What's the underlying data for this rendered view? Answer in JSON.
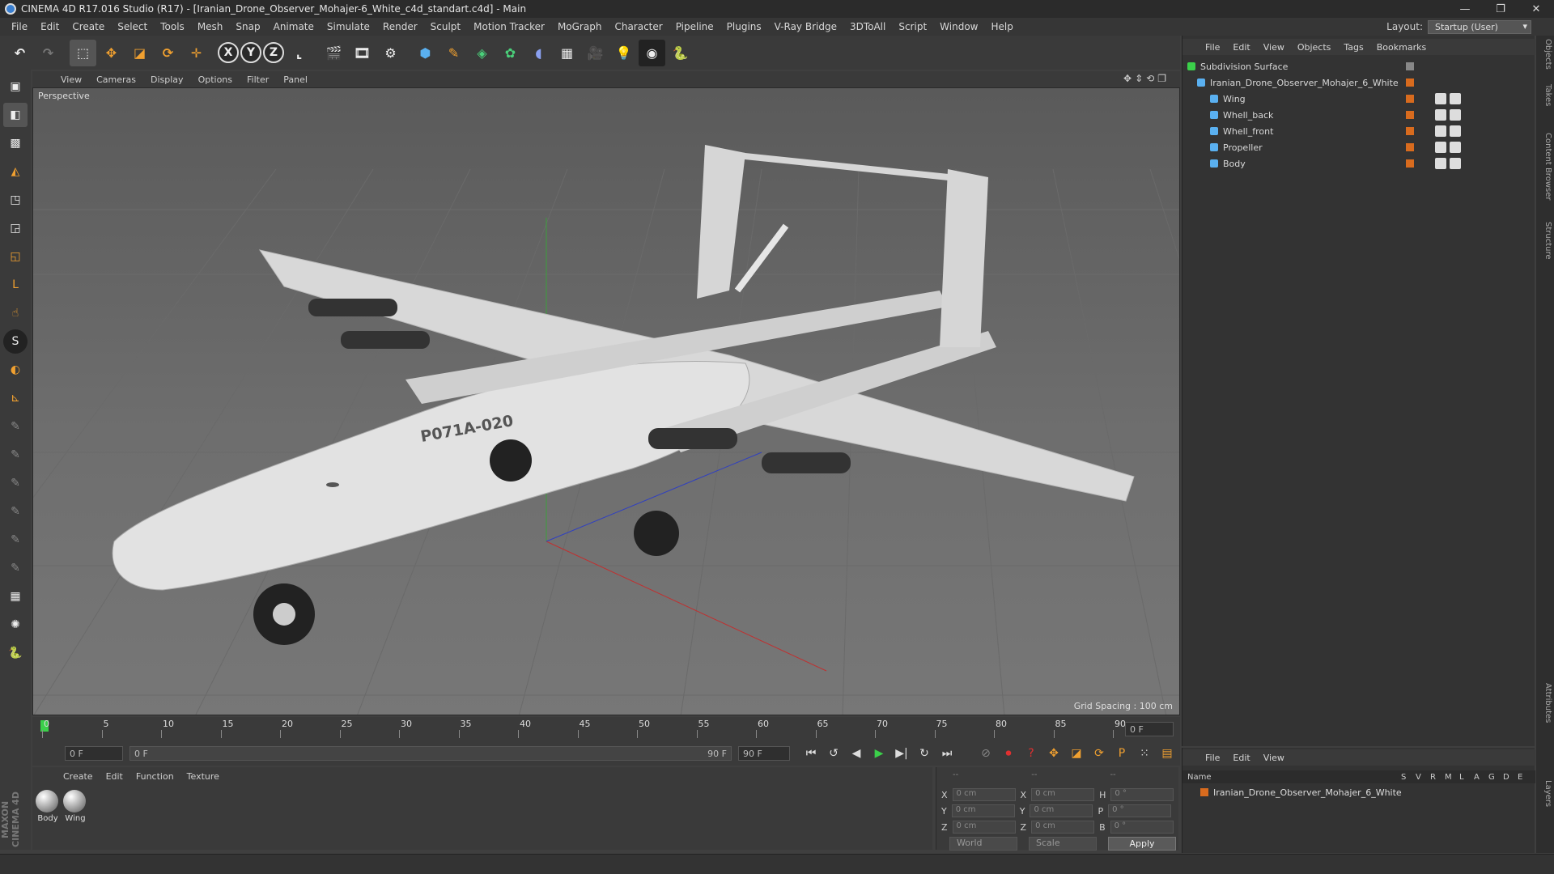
{
  "app": {
    "title": "CINEMA 4D R17.016 Studio (R17) - [Iranian_Drone_Observer_Mohajer-6_White_c4d_standart.c4d] - Main",
    "menus": [
      "File",
      "Edit",
      "Create",
      "Select",
      "Tools",
      "Mesh",
      "Snap",
      "Animate",
      "Simulate",
      "Render",
      "Sculpt",
      "Motion Tracker",
      "MoGraph",
      "Character",
      "Pipeline",
      "Plugins",
      "V-Ray Bridge",
      "3DToAll",
      "Script",
      "Window",
      "Help"
    ],
    "layout_label": "Layout:",
    "layout_value": "Startup (User)"
  },
  "toolbar": {
    "axis_x": "X",
    "axis_y": "Y",
    "axis_z": "Z"
  },
  "viewport": {
    "menus": [
      "View",
      "Cameras",
      "Display",
      "Options",
      "Filter",
      "Panel"
    ],
    "label": "Perspective",
    "grid_spacing": "Grid Spacing : 100 cm",
    "drone_marking": "P071A-020"
  },
  "timeline": {
    "ticks": [
      "0",
      "5",
      "10",
      "15",
      "20",
      "25",
      "30",
      "35",
      "40",
      "45",
      "50",
      "55",
      "60",
      "65",
      "70",
      "75",
      "80",
      "85",
      "90"
    ],
    "frame_field": "0 F",
    "start_field": "0 F",
    "range_start": "0 F",
    "range_end": "90 F",
    "end_field": "90 F"
  },
  "materials": {
    "menus": [
      "Create",
      "Edit",
      "Function",
      "Texture"
    ],
    "items": [
      "Body",
      "Wing"
    ]
  },
  "coordinates": {
    "x_label": "X",
    "y_label": "Y",
    "z_label": "Z",
    "h_label": "H",
    "p_label": "P",
    "b_label": "B",
    "pos_x": "0 cm",
    "pos_y": "0 cm",
    "pos_z": "0 cm",
    "size_x": "0 cm",
    "size_y": "0 cm",
    "size_z": "0 cm",
    "rot_h": "0 °",
    "rot_p": "0 °",
    "rot_b": "0 °",
    "mode": "World",
    "scale_mode": "Scale",
    "apply": "Apply",
    "header": "--"
  },
  "object_manager": {
    "menus": [
      "File",
      "Edit",
      "View",
      "Objects",
      "Tags",
      "Bookmarks"
    ],
    "objects": [
      {
        "name": "Subdivision Surface"
      },
      {
        "name": "Iranian_Drone_Observer_Mohajer_6_White"
      },
      {
        "name": "Wing"
      },
      {
        "name": "Whell_back"
      },
      {
        "name": "Whell_front"
      },
      {
        "name": "Propeller"
      },
      {
        "name": "Body"
      }
    ]
  },
  "attributes": {
    "menus": [
      "File",
      "Edit",
      "View"
    ],
    "columns": [
      "Name",
      "S",
      "V",
      "R",
      "M",
      "L",
      "A",
      "G",
      "D",
      "E"
    ],
    "row": "Iranian_Drone_Observer_Mohajer_6_White"
  },
  "side_tabs": [
    "Objects",
    "Takes",
    "Content Browser",
    "Structure",
    "Attributes",
    "Layers"
  ],
  "maxon": "MAXON CINEMA 4D",
  "colors": {
    "accent": "#d86b1e",
    "panel": "#3a3a3a",
    "dark": "#333333"
  }
}
